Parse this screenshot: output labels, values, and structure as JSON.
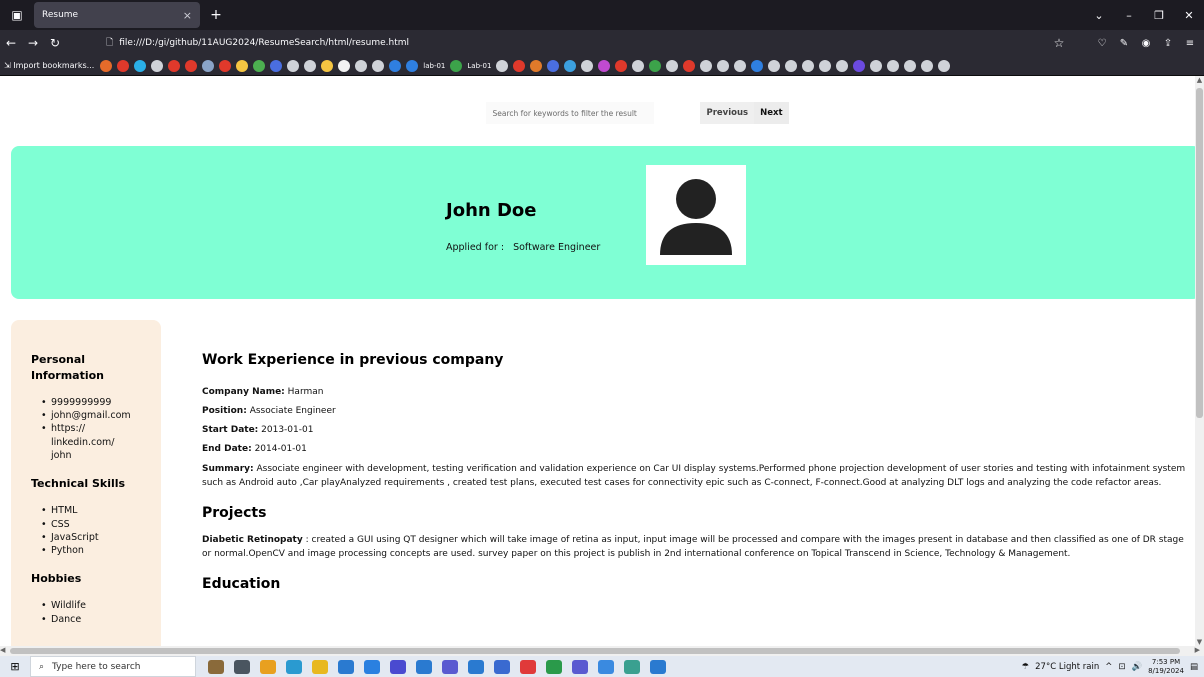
{
  "browser": {
    "tab_title": "Resume",
    "tab_close": "×",
    "new_tab": "+",
    "url": "file:///D:/gi/github/11AUG2024/ResumeSearch/html/resume.html",
    "import_bookmarks": "Import bookmarks...",
    "bookmark_texts": [
      "lab-01",
      "Lab-01"
    ],
    "bookmark_colors": [
      "#e66b2a",
      "#e0392b",
      "#2ab0e8",
      "#cfd2d8",
      "#e0392b",
      "#e0392b",
      "#8aa4c8",
      "#e0392b",
      "#f5c542",
      "#4caf50",
      "#4a6ee0",
      "#cfd2d8",
      "#cfd2d8",
      "#f5c542",
      "#f2f2f2",
      "#cfd2d8",
      "#cfd2d8",
      "#2f7fe0",
      "#2f7fe0",
      "#3ca34a",
      "#cfd2d8",
      "#e0392b",
      "#e07a2a",
      "#4a6ee0",
      "#3ca0e0",
      "#cfd2d8",
      "#c04ad0",
      "#e0392b",
      "#cfd2d8",
      "#3ca34a",
      "#cfd2d8",
      "#e0392b",
      "#cfd2d8",
      "#cfd2d8",
      "#cfd2d8",
      "#2f7fe0",
      "#cfd2d8",
      "#cfd2d8",
      "#cfd2d8",
      "#cfd2d8",
      "#cfd2d8",
      "#6b4ae0",
      "#cfd2d8",
      "#cfd2d8",
      "#cfd2d8",
      "#cfd2d8",
      "#cfd2d8"
    ]
  },
  "search": {
    "placeholder": "Search for keywords to filter the result",
    "previous_label": "Previous",
    "next_label": "Next"
  },
  "header": {
    "name": "John Doe",
    "applied_label": "Applied for :",
    "applied_role": "Software Engineer",
    "band_color": "#7fffd4"
  },
  "sidebar": {
    "personal_heading": "Personal Information",
    "personal_items": [
      "9999999999",
      "john@gmail.com",
      "https:// linkedin.com/ john"
    ],
    "skills_heading": "Technical Skills",
    "skills": [
      "HTML",
      "CSS",
      "JavaScript",
      "Python"
    ],
    "hobbies_heading": "Hobbies",
    "hobbies": [
      "Wildlife",
      "Dance"
    ],
    "bg_color": "#fbeee0"
  },
  "work": {
    "heading": "Work Experience in previous company",
    "company_label": "Company Name:",
    "company": "Harman",
    "position_label": "Position:",
    "position": "Associate Engineer",
    "start_label": "Start Date:",
    "start": "2013-01-01",
    "end_label": "End Date:",
    "end": "2014-01-01",
    "summary_label": "Summary:",
    "summary": "Associate engineer with development, testing verification and validation experience on Car UI display systems.Performed phone projection development of user stories and testing with infotainment system such as Android auto ,Car playAnalyzed requirements , created test plans, executed test cases for connectivity epic such as C-connect, F-connect.Good at analyzing DLT logs and analyzing the code refactor areas."
  },
  "projects": {
    "heading": "Projects",
    "title": "Diabetic Retinopaty",
    "description": ": created a GUI using QT designer which will take image of retina as input, input image will be processed and compare with the images present in database and then classified as one of DR stage or normal.OpenCV and image processing concepts are used. survey paper on this project is publish in 2nd international conference on Topical Transcend in Science, Technology & Management."
  },
  "education": {
    "heading": "Education"
  },
  "taskbar": {
    "search_placeholder": "Type here to search",
    "weather": "27°C  Light rain",
    "time": "7:53 PM",
    "date": "8/19/2024",
    "app_colors": [
      "#8a6a3a",
      "#4a5560",
      "#e8a020",
      "#2a9ad0",
      "#e8b820",
      "#2a7ad0",
      "#2a80e0",
      "#4a4ad0",
      "#2a7ad0",
      "#5a5ad0",
      "#2a7ad0",
      "#3a6ad0",
      "#e03a3a",
      "#2a9a4a",
      "#5a5ad0",
      "#3a8ae0",
      "#3aa090",
      "#2a7ad0"
    ]
  }
}
